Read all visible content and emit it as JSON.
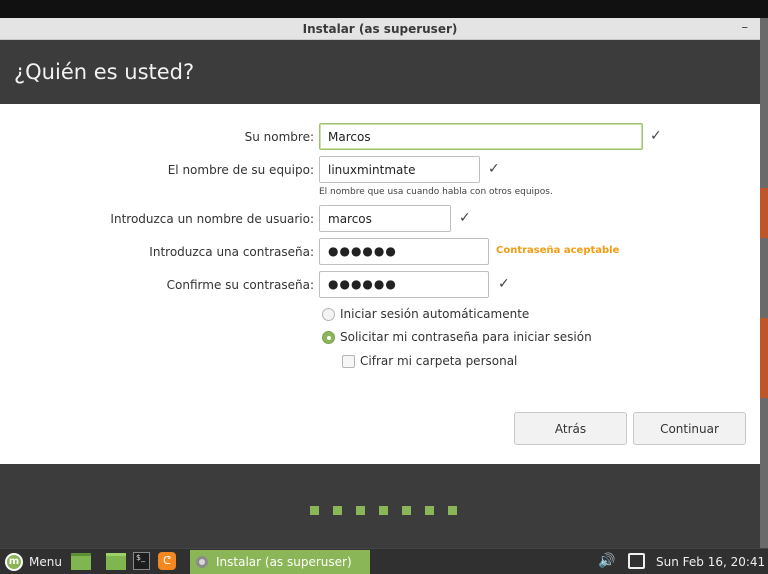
{
  "window": {
    "title": "Instalar (as superuser)",
    "minimize": "–"
  },
  "header": {
    "heading": "¿Quién es usted?"
  },
  "form": {
    "name": {
      "label": "Su nombre:",
      "value": "Marcos"
    },
    "computer": {
      "label": "El nombre de su equipo:",
      "value": "linuxmintmate",
      "hint": "El nombre que usa cuando habla con otros equipos."
    },
    "username": {
      "label": "Introduzca un nombre de usuario:",
      "value": "marcos"
    },
    "password": {
      "label": "Introduzca una contraseña:",
      "value": "●●●●●●",
      "strength": "Contraseña aceptable"
    },
    "confirm": {
      "label": "Confirme su contraseña:",
      "value": "●●●●●●"
    },
    "check": "✓"
  },
  "options": {
    "autologin": "Iniciar sesión automáticamente",
    "require_password": "Solicitar mi contraseña para iniciar sesión",
    "encrypt_home": "Cifrar mi carpeta personal"
  },
  "buttons": {
    "back": "Atrás",
    "continue": "Continuar"
  },
  "progress": {
    "steps_total": 7,
    "color": "#8ab657"
  },
  "taskbar": {
    "menu": "Menu",
    "mint_logo": "m",
    "terminal_glyph": "$_",
    "firefox_glyph": "ᕦ",
    "task": "Instalar (as superuser)",
    "volume": "🔊",
    "clock": "Sun Feb 16, 20:41"
  },
  "colors": {
    "accent": "#8ab657",
    "header_bg": "#3c3c3c",
    "strength_ok": "#f39c12"
  }
}
